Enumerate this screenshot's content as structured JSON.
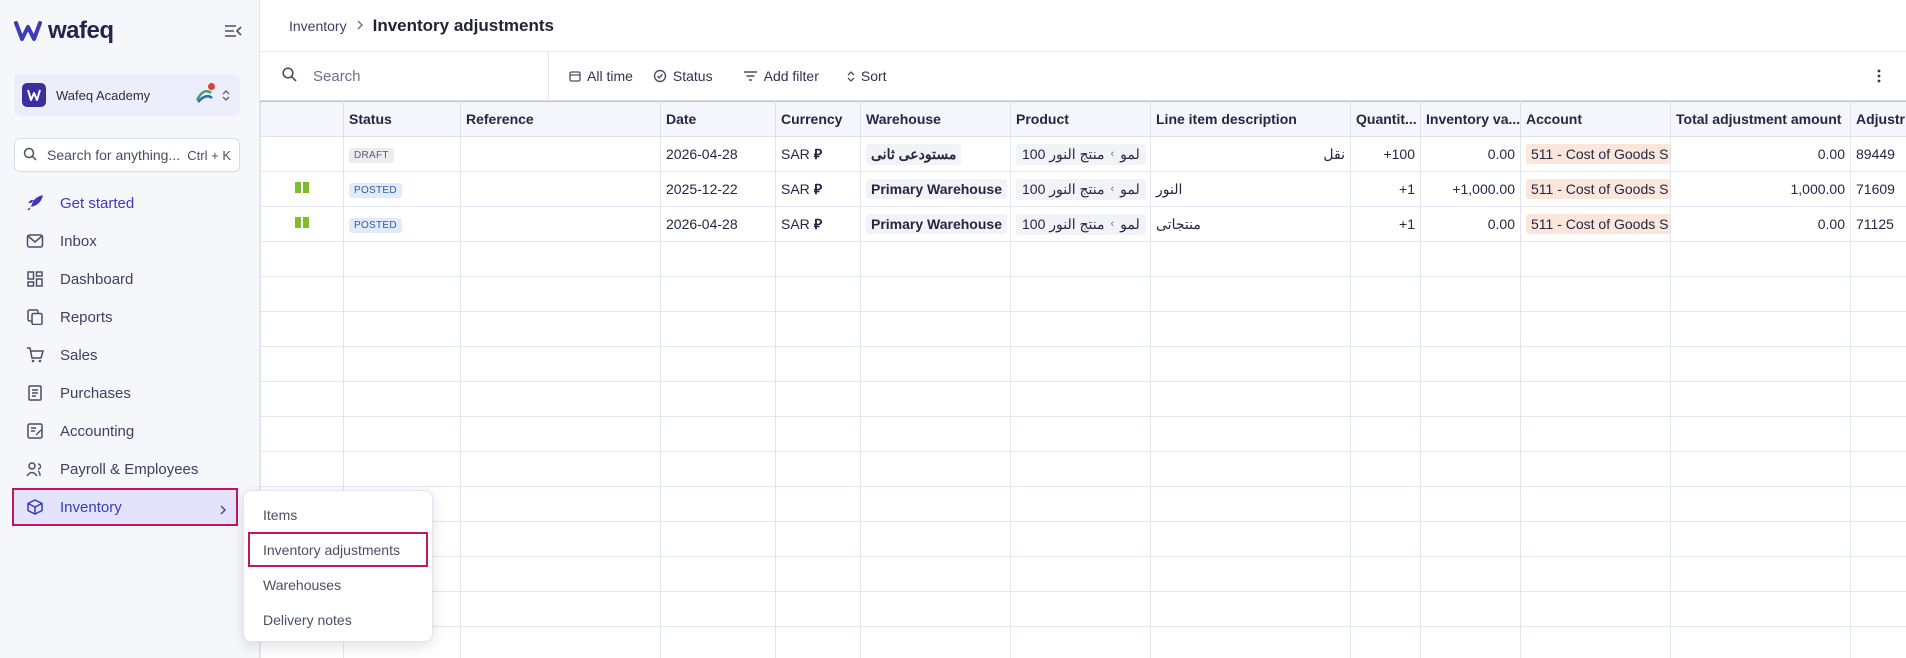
{
  "brand": {
    "name": "wafeq",
    "accent": "#3b3bb8",
    "highlight": "#c2185b"
  },
  "org": {
    "name": "Wafeq Academy"
  },
  "search": {
    "placeholder": "Search for anything...",
    "shortcut": "Ctrl + K"
  },
  "nav": {
    "items": [
      {
        "label": "Get started",
        "icon": "rocket-icon"
      },
      {
        "label": "Inbox",
        "icon": "inbox-icon"
      },
      {
        "label": "Dashboard",
        "icon": "dashboard-icon"
      },
      {
        "label": "Reports",
        "icon": "reports-icon"
      },
      {
        "label": "Sales",
        "icon": "cart-icon"
      },
      {
        "label": "Purchases",
        "icon": "receipt-icon"
      },
      {
        "label": "Accounting",
        "icon": "ledger-icon"
      },
      {
        "label": "Payroll & Employees",
        "icon": "people-icon"
      },
      {
        "label": "Inventory",
        "icon": "box-icon"
      }
    ]
  },
  "submenu": {
    "items": [
      "Items",
      "Inventory adjustments",
      "Warehouses",
      "Delivery notes"
    ]
  },
  "breadcrumb": {
    "parent": "Inventory",
    "current": "Inventory adjustments"
  },
  "toolbar": {
    "search_placeholder": "Search",
    "all_time": "All time",
    "status": "Status",
    "add_filter": "Add filter",
    "sort": "Sort"
  },
  "table": {
    "columns": [
      "Status",
      "Reference",
      "Date",
      "Currency",
      "Warehouse",
      "Product",
      "Line item description",
      "Quantit...",
      "Inventory va...",
      "Account",
      "Total adjustment amount",
      "Adjustr"
    ],
    "rows": [
      {
        "status": "DRAFT",
        "reference": "",
        "date": "2026-04-28",
        "currency": "SAR",
        "warehouse": "مستودعی ثانی",
        "product_prefix": "منتج النور 100",
        "product_suffix": "لمو",
        "description": "نقل",
        "quantity": "+100",
        "inventory_value": "0.00",
        "account": "511 - Cost of Goods S",
        "total": "0.00",
        "adjustment": "89449"
      },
      {
        "status": "POSTED",
        "reference": "",
        "date": "2025-12-22",
        "currency": "SAR",
        "warehouse": "Primary Warehouse",
        "product_prefix": "منتج النور 100",
        "product_suffix": "لمو",
        "description": "النور",
        "quantity": "+1",
        "inventory_value": "+1,000.00",
        "account": "511 - Cost of Goods S",
        "total": "1,000.00",
        "adjustment": "71609"
      },
      {
        "status": "POSTED",
        "reference": "",
        "date": "2026-04-28",
        "currency": "SAR",
        "warehouse": "Primary Warehouse",
        "product_prefix": "منتج النور 100",
        "product_suffix": "لمو",
        "description": "منتجاتی",
        "quantity": "+1",
        "inventory_value": "0.00",
        "account": "511 - Cost of Goods S",
        "total": "0.00",
        "adjustment": "71125"
      }
    ],
    "sar_symbol": "⃁"
  }
}
